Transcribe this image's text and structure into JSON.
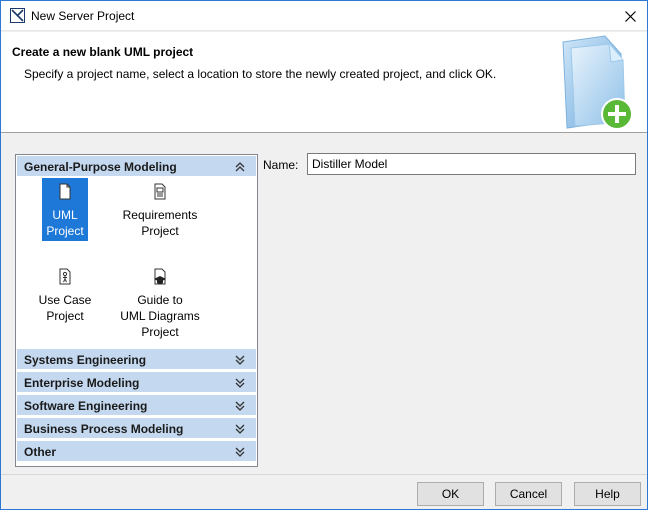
{
  "window": {
    "title": "New Server Project"
  },
  "header": {
    "title": "Create a new blank UML project",
    "description": "Specify a project name, select a location to store the newly created project, and click OK."
  },
  "categories": {
    "expanded": {
      "label": "General-Purpose Modeling",
      "items": [
        {
          "line1": "UML",
          "line2": "Project",
          "line3": "",
          "icon": "uml-project-icon",
          "selected": true
        },
        {
          "line1": "Requirements",
          "line2": "Project",
          "line3": "",
          "icon": "requirements-project-icon",
          "selected": false
        },
        {
          "line1": "Use Case",
          "line2": "Project",
          "line3": "",
          "icon": "use-case-project-icon",
          "selected": false
        },
        {
          "line1": "Guide to",
          "line2": "UML Diagrams",
          "line3": "Project",
          "icon": "guide-uml-diagrams-icon",
          "selected": false
        }
      ]
    },
    "collapsed": [
      "Systems Engineering",
      "Enterprise Modeling",
      "Software Engineering",
      "Business Process Modeling",
      "Other"
    ]
  },
  "name_field": {
    "label": "Name:",
    "value": "Distiller Model"
  },
  "buttons": {
    "ok": "OK",
    "cancel": "Cancel",
    "help": "Help"
  },
  "colors": {
    "accent": "#1e78d7",
    "category_header": "#c4d9f0",
    "plus_badge": "#5ab837"
  }
}
